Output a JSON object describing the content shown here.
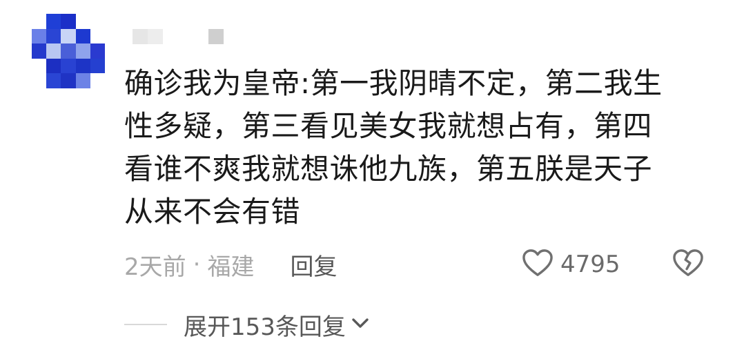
{
  "comment": {
    "avatar_icon": "pixelated-avatar-icon",
    "avatar_pixels": [
      [
        "#ffffff",
        "#1f3fd6",
        "#1b2fc8",
        "#ffffff",
        "#ffffff"
      ],
      [
        "#6a80e8",
        "#2a45d4",
        "#c8d4f6",
        "#1d39d0",
        "#ffffff"
      ],
      [
        "#2439cc",
        "#b9c7f2",
        "#4a5fd8",
        "#8fa3ec",
        "#2a3ad0"
      ],
      [
        "#ffffff",
        "#1c2fc2",
        "#2942d2",
        "#1d34c6",
        "#2540d0"
      ],
      [
        "#ffffff",
        "#2a45d4",
        "#1f33c4",
        "#6c82e6",
        "#ffffff"
      ]
    ],
    "username_pixels": [
      "#e6e6e6",
      "#ededed",
      "#ffffff",
      "#ffffff",
      "#ffffff",
      "#cfcfcf"
    ],
    "content_lines": [
      "确诊我为皇帝:第一我阴晴不定，第二我生",
      "性多疑，第三看见美女我就想占有，第四",
      "看谁不爽我就想诛他九族，第五朕是天子",
      "从来不会有错"
    ],
    "time": "2天前",
    "separator": "·",
    "location": "福建",
    "reply_label": "回复",
    "like_icon": "heart-outline-icon",
    "like_count": "4795",
    "dislike_icon": "broken-heart-icon",
    "expand_label": "展开153条回复",
    "expand_icon": "chevron-down-icon"
  }
}
